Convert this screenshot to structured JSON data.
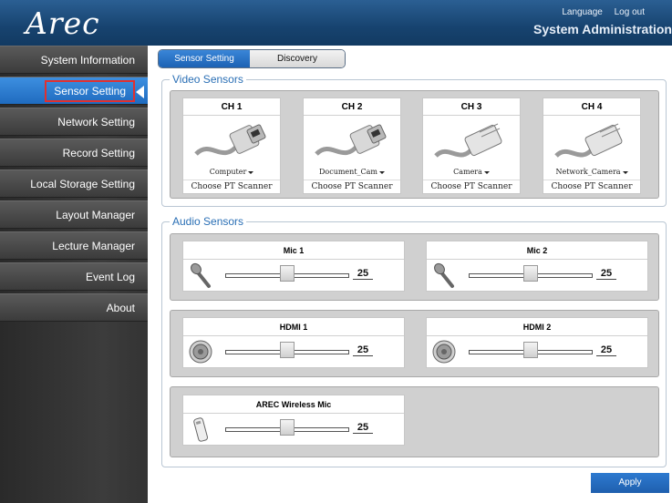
{
  "header": {
    "logo_text": "Arec",
    "language_link": "Language",
    "logout_link": "Log out",
    "title": "System Administration"
  },
  "sidebar": {
    "items": [
      {
        "label": "System Information"
      },
      {
        "label": "Sensor Setting"
      },
      {
        "label": "Network Setting"
      },
      {
        "label": "Record Setting"
      },
      {
        "label": "Local Storage Setting"
      },
      {
        "label": "Layout Manager"
      },
      {
        "label": "Lecture Manager"
      },
      {
        "label": "Event Log"
      },
      {
        "label": "About"
      }
    ],
    "active_index": 1
  },
  "tabs": [
    {
      "label": "Sensor Setting"
    },
    {
      "label": "Discovery"
    }
  ],
  "video_sensors": {
    "title": "Video Sensors",
    "channels": [
      {
        "name": "CH 1",
        "source": "Computer",
        "scanner": "Choose PT Scanner",
        "plug_icon": "hdmi-plug-icon"
      },
      {
        "name": "CH 2",
        "source": "Document_Cam",
        "scanner": "Choose PT Scanner",
        "plug_icon": "hdmi-plug-icon"
      },
      {
        "name": "CH 3",
        "source": "Camera",
        "scanner": "Choose PT Scanner",
        "plug_icon": "ethernet-plug-icon"
      },
      {
        "name": "CH 4",
        "source": "Network_Camera",
        "scanner": "Choose PT Scanner",
        "plug_icon": "ethernet-plug-icon"
      }
    ]
  },
  "audio_sensors": {
    "title": "Audio Sensors",
    "items": [
      {
        "name": "Mic 1",
        "value": "25",
        "level": 0.5,
        "icon": "microphone-icon"
      },
      {
        "name": "Mic 2",
        "value": "25",
        "level": 0.5,
        "icon": "microphone-icon"
      },
      {
        "name": "HDMI 1",
        "value": "25",
        "level": 0.5,
        "icon": "speaker-icon"
      },
      {
        "name": "HDMI 2",
        "value": "25",
        "level": 0.5,
        "icon": "speaker-icon"
      },
      {
        "name": "AREC Wireless Mic",
        "value": "25",
        "level": 0.5,
        "icon": "wireless-mic-icon"
      }
    ]
  },
  "apply_label": "Apply",
  "colors": {
    "header": "#1a4a7a",
    "accent": "#2a7ad0",
    "section_title": "#2a6fb5",
    "highlight_border": "#e03030"
  }
}
